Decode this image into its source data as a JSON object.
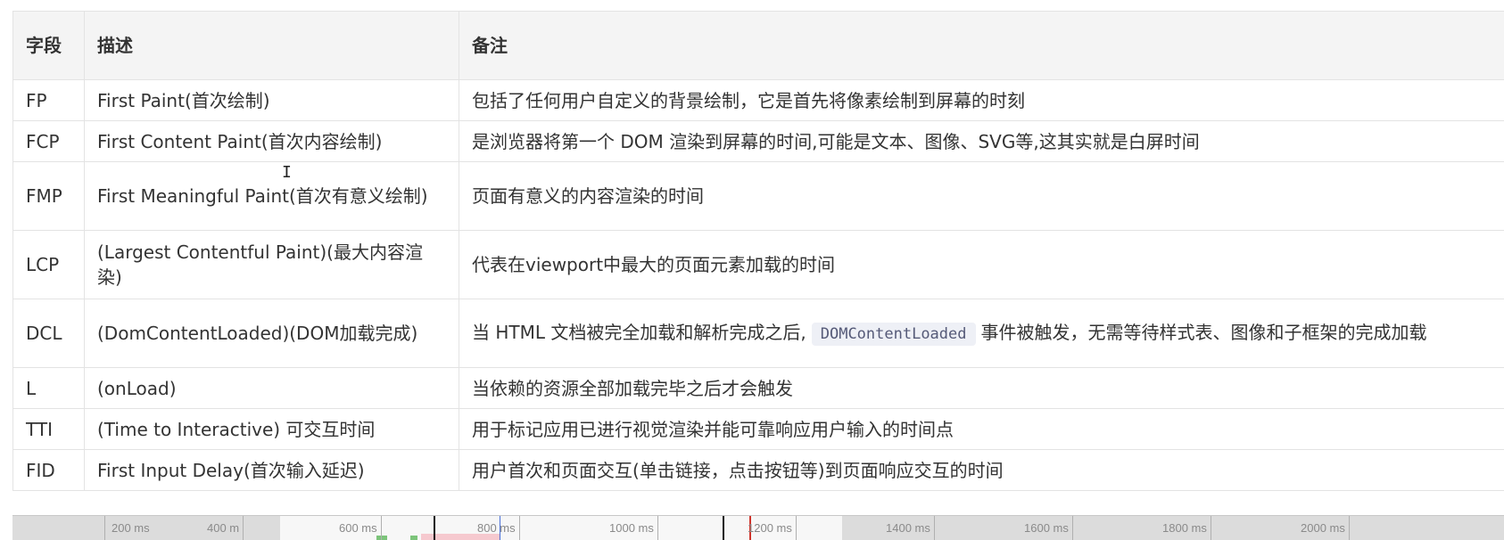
{
  "table": {
    "headers": [
      "字段",
      "描述",
      "备注"
    ],
    "rows": [
      {
        "field": "FP",
        "desc": "First Paint(首次绘制)",
        "note": "包括了任何用户自定义的背景绘制，它是首先将像素绘制到屏幕的时刻"
      },
      {
        "field": "FCP",
        "desc": "First Content Paint(首次内容绘制)",
        "note": "是浏览器将第一个 DOM 渲染到屏幕的时间,可能是文本、图像、SVG等,这其实就是白屏时间"
      },
      {
        "field": "FMP",
        "desc": "First Meaningful Paint(首次有意义绘制)",
        "note": "页面有意义的内容渲染的时间"
      },
      {
        "field": "LCP",
        "desc": "(Largest Contentful Paint)(最大内容渲染)",
        "note": "代表在viewport中最大的页面元素加载的时间"
      },
      {
        "field": "DCL",
        "desc": "(DomContentLoaded)(DOM加载完成)",
        "note_before": "当 HTML 文档被完全加载和解析完成之后,",
        "note_code": "DOMContentLoaded",
        "note_after": "事件被触发，无需等待样式表、图像和子框架的完成加载"
      },
      {
        "field": "L",
        "desc": "(onLoad)",
        "note": "当依赖的资源全部加载完毕之后才会触发"
      },
      {
        "field": "TTI",
        "desc": "(Time to Interactive) 可交互时间",
        "note": "用于标记应用已进行视觉渲染并能可靠响应用户输入的时间点"
      },
      {
        "field": "FID",
        "desc": "First Input Delay(首次输入延迟)",
        "note": "用户首次和页面交互(单击链接，点击按钮等)到页面响应交互的时间"
      }
    ]
  },
  "timeline": {
    "ticks": [
      {
        "label": "200 ms",
        "ms": 200
      },
      {
        "label": "400 m",
        "ms": 400
      },
      {
        "label": "600 ms",
        "ms": 600
      },
      {
        "label": "800 ms",
        "ms": 800
      },
      {
        "label": "1000 ms",
        "ms": 1000
      },
      {
        "label": "1200 ms",
        "ms": 1200
      },
      {
        "label": "1400 ms",
        "ms": 1400
      },
      {
        "label": "1600 ms",
        "ms": 1600
      },
      {
        "label": "1800 ms",
        "ms": 1800
      },
      {
        "label": "2000 ms",
        "ms": 2000
      }
    ]
  },
  "colors": {
    "header_bg": "#f4f4f4",
    "border": "#e3e3e3",
    "code_bg": "#eef0f6",
    "marker_red": "#d0342c"
  }
}
